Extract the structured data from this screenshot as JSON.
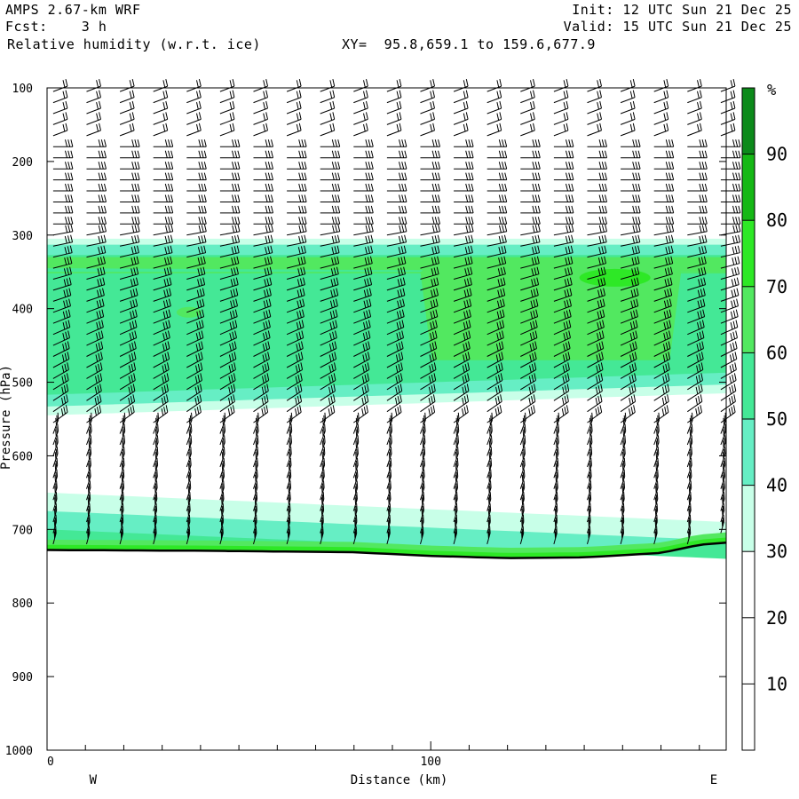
{
  "header": {
    "model": "AMPS 2.67-km WRF",
    "fcst_label": "Fcst:",
    "fcst_value": "3 h",
    "field": "Relative humidity (w.r.t. ice)",
    "xy_label": "XY=",
    "xy_range": "95.8,659.1 to 159.6,677.9",
    "init": "Init: 12 UTC Sun 21 Dec 25",
    "valid": "Valid: 15 UTC Sun 21 Dec 25"
  },
  "chart_data": {
    "type": "heatmap",
    "title": "Relative humidity (w.r.t. ice)",
    "xlabel": "Distance (km)",
    "ylabel": "Pressure (hPa)",
    "xlim": [
      0,
      177
    ],
    "ylim": [
      1000,
      100
    ],
    "x_ticks": [
      0,
      100
    ],
    "y_ticks": [
      100,
      200,
      300,
      400,
      500,
      600,
      700,
      800,
      900,
      1000
    ],
    "x_end_labels": {
      "left": "W",
      "right": "E"
    },
    "colorbar": {
      "unit": "%",
      "levels": [
        0,
        10,
        20,
        30,
        40,
        50,
        60,
        70,
        80,
        90,
        100
      ],
      "tick_labels": [
        10,
        20,
        30,
        40,
        50,
        60,
        70,
        80,
        90
      ],
      "colors": [
        "#ffffff",
        "#ffffff",
        "#ffffff",
        "#c8ffe8",
        "#66eec4",
        "#44e896",
        "#52e860",
        "#2ee826",
        "#15b815",
        "#0c8a1a"
      ]
    },
    "moist_layers": [
      {
        "name": "upper moist layer",
        "p_top": 305,
        "p_bottom_west": 545,
        "p_bottom_east": 515,
        "rh_max": 75
      },
      {
        "name": "near-surface moist layer",
        "p_top_west": 650,
        "p_top_east": 690,
        "rh_max": 75
      }
    ],
    "terrain": {
      "x": [
        0,
        40,
        80,
        100,
        120,
        140,
        160,
        170,
        177
      ],
      "p": [
        728,
        729,
        731,
        736,
        739,
        738,
        732,
        721,
        718
      ]
    },
    "wind_barbs": {
      "columns": 21,
      "levels_hPa_spacing": 15
    }
  }
}
